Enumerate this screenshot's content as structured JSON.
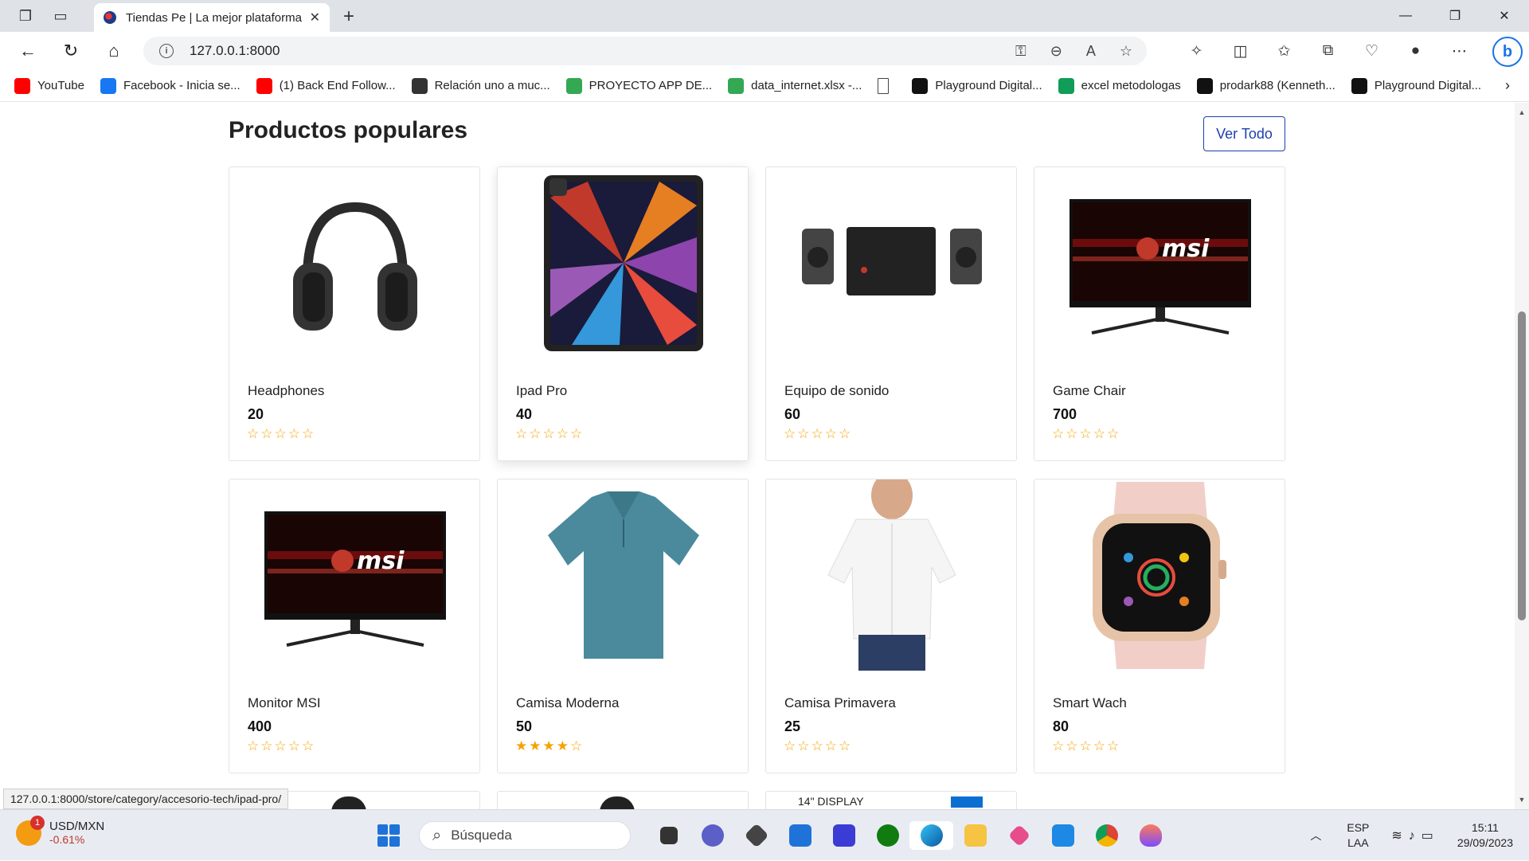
{
  "browser": {
    "tab_title": "Tiendas Pe | La mejor plataforma",
    "address": "127.0.0.1:8000",
    "status_url": "127.0.0.1:8000/store/category/accesorio-tech/ipad-pro/"
  },
  "bookmarks": [
    {
      "label": "YouTube",
      "icon": "youtube-icon",
      "color": "#ff0000"
    },
    {
      "label": "Facebook - Inicia se...",
      "icon": "facebook-icon",
      "color": "#1877f2"
    },
    {
      "label": "(1) Back End Follow...",
      "icon": "youtube-icon",
      "color": "#ff0000"
    },
    {
      "label": "Relación uno a muc...",
      "icon": "site-icon",
      "color": "#333333"
    },
    {
      "label": "PROYECTO APP DE...",
      "icon": "google-drive-icon",
      "color": "#34a853"
    },
    {
      "label": "data_internet.xlsx -...",
      "icon": "google-drive-icon",
      "color": "#34a853"
    },
    {
      "label": "",
      "icon": "page-icon",
      "color": "#ffffff"
    },
    {
      "label": "Playground Digital...",
      "icon": "playground-icon",
      "color": "#111111"
    },
    {
      "label": "excel metodologas",
      "icon": "sheets-icon",
      "color": "#0f9d58"
    },
    {
      "label": "prodark88 (Kenneth...",
      "icon": "github-icon",
      "color": "#111111"
    },
    {
      "label": "Playground Digital...",
      "icon": "playground-icon",
      "color": "#111111"
    }
  ],
  "page": {
    "section_title": "Productos populares",
    "view_all": "Ver Todo",
    "products": [
      {
        "name": "Headphones",
        "price": "20",
        "stars": "☆☆☆☆☆",
        "img": "headphones"
      },
      {
        "name": "Ipad Pro",
        "price": "40",
        "stars": "☆☆☆☆☆",
        "img": "ipad"
      },
      {
        "name": "Equipo de sonido",
        "price": "60",
        "stars": "☆☆☆☆☆",
        "img": "speakers"
      },
      {
        "name": "Game Chair",
        "price": "700",
        "stars": "☆☆☆☆☆",
        "img": "monitor"
      },
      {
        "name": "Monitor MSI",
        "price": "400",
        "stars": "☆☆☆☆☆",
        "img": "monitor"
      },
      {
        "name": "Camisa Moderna",
        "price": "50",
        "stars": "★★★★☆",
        "img": "polo"
      },
      {
        "name": "Camisa Primavera",
        "price": "25",
        "stars": "☆☆☆☆☆",
        "img": "shirt"
      },
      {
        "name": "Smart Wach",
        "price": "80",
        "stars": "☆☆☆☆☆",
        "img": "watch"
      }
    ],
    "msi_logo": "msi",
    "partial_card_text": "14\" DISPLAY"
  },
  "taskbar": {
    "ticker_label": "USD/MXN",
    "ticker_change": "-0.61%",
    "ticker_badge": "1",
    "search_placeholder": "Búsqueda",
    "lang_top": "ESP",
    "lang_bottom": "LAA",
    "time": "15:11",
    "date": "29/09/2023"
  }
}
